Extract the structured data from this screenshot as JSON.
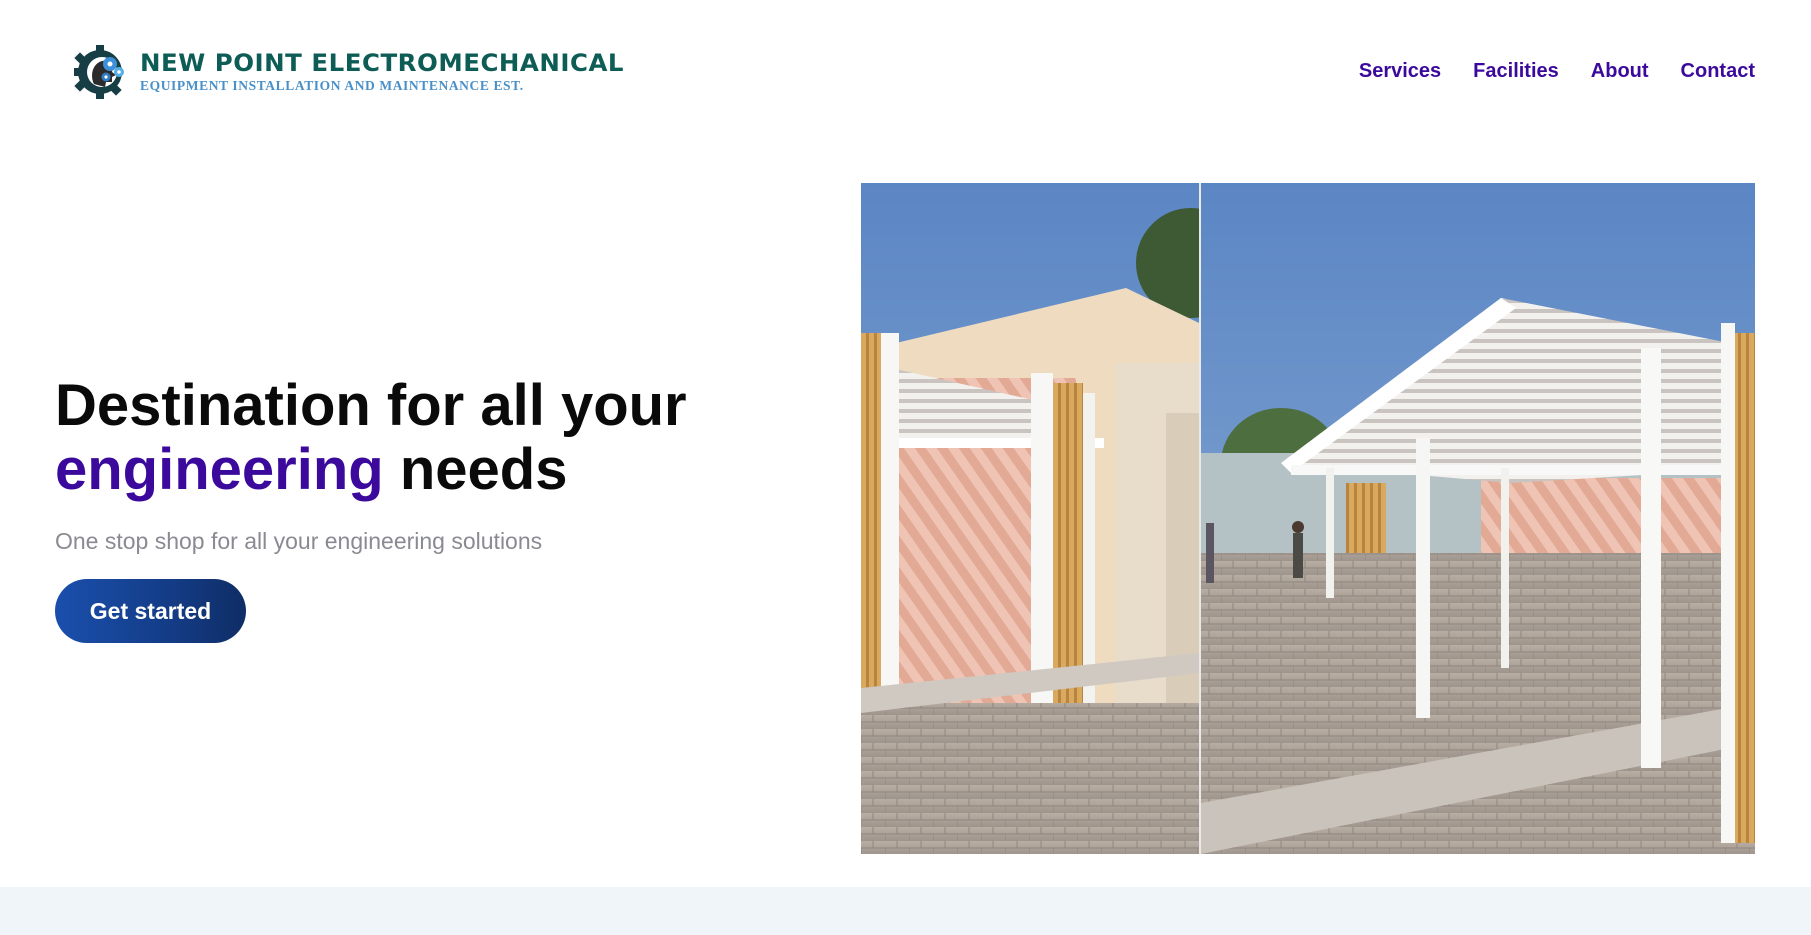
{
  "brand": {
    "name": "NEW POINT ELECTROMECHANICAL",
    "tagline": "EQUIPMENT INSTALLATION AND MAINTENANCE EST.",
    "logo_icon": "gear-head-logo",
    "colors": {
      "name": "#0d5c55",
      "tagline": "#4a90c8"
    }
  },
  "nav": {
    "items": [
      {
        "label": "Services"
      },
      {
        "label": "Facilities"
      },
      {
        "label": "About"
      },
      {
        "label": "Contact"
      }
    ],
    "color": "#3b0a9c"
  },
  "hero": {
    "title_line1": "Destination for all your",
    "title_accent": "engineering",
    "title_rest": "needs",
    "subtitle": "One stop shop for all your engineering solutions",
    "cta_label": "Get started",
    "accent_color": "#3b0a9c",
    "cta_color": "#1a4fad"
  },
  "hero_image": {
    "subject": "pergola-carport-photo"
  },
  "footer_band": {
    "color": "#f0f5f9"
  }
}
